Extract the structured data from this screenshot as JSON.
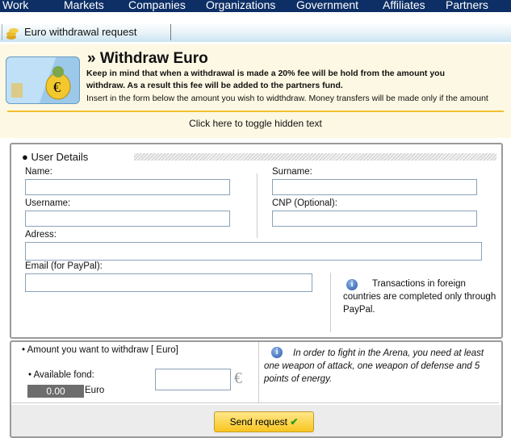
{
  "nav": {
    "items": [
      "Work",
      "Markets",
      "Companies",
      "Organizations",
      "Government",
      "Affiliates",
      "Partners"
    ]
  },
  "tab": {
    "title": "Euro withdrawal request",
    "icon": "coins-icon"
  },
  "intro": {
    "title": "» Withdraw Euro",
    "bold_line1": "Keep in mind that when a withdrawal is made a 20% fee will be hold from the amount you",
    "bold_line2": "withdraw. As a result this fee will be added to the partners fund.",
    "text": "Insert in the form below the amount you wish to widthdraw. Money transfers will be made only if the amount",
    "toggle": "Click here to toggle hidden text"
  },
  "user_details": {
    "heading": "User Details",
    "name_label": "Name:",
    "surname_label": "Surname:",
    "username_label": "Username:",
    "cnp_label": "CNP (Optional):",
    "address_label": "Adress:",
    "email_label": "Email (for PayPal):",
    "paypal_note": "Transactions in foreign countries are completed only through PayPal."
  },
  "withdraw": {
    "amount_label": "Amount you want to withdraw [ Euro]",
    "available_label": "Available fond:",
    "available_value": "0.00",
    "currency": "Euro",
    "arena_note": "In order to fight in the Arena, you need at least one weapon of attack, one weapon of defense and 5 points of energy.",
    "send_label": "Send request"
  },
  "colors": {
    "nav": "#0d2f66",
    "panel": "#fdf8e3",
    "accent": "#f0c030"
  }
}
